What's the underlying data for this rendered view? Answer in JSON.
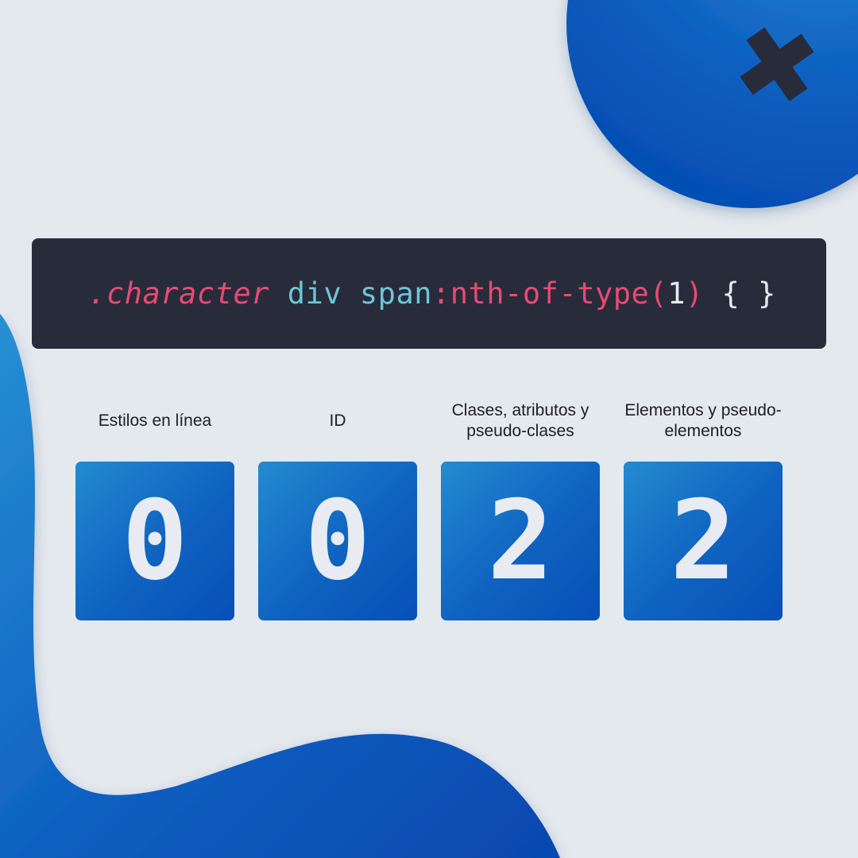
{
  "code": {
    "class_selector": ".character",
    "space1": " ",
    "tag_div": "div",
    "space2": " ",
    "tag_span": "span",
    "pseudo": ":nth-of-type",
    "paren_open": "(",
    "arg": "1",
    "paren_close": ")",
    "space3": " ",
    "braces": "{ }"
  },
  "specificity": [
    {
      "label": "Estilos en línea",
      "value": "0"
    },
    {
      "label": "ID",
      "value": "0"
    },
    {
      "label": "Clases, atributos y pseudo-clases",
      "value": "2"
    },
    {
      "label": "Elementos y pseudo-elementos",
      "value": "2"
    }
  ],
  "colors": {
    "background": "#e4e9ee",
    "code_panel": "#282b3a",
    "accent_blue": "#0f62c0",
    "selector_pink": "#e84a73",
    "tag_cyan": "#6cc6d8",
    "cross_icon": "#282b3a"
  },
  "icons": [
    "close-cross-icon"
  ]
}
